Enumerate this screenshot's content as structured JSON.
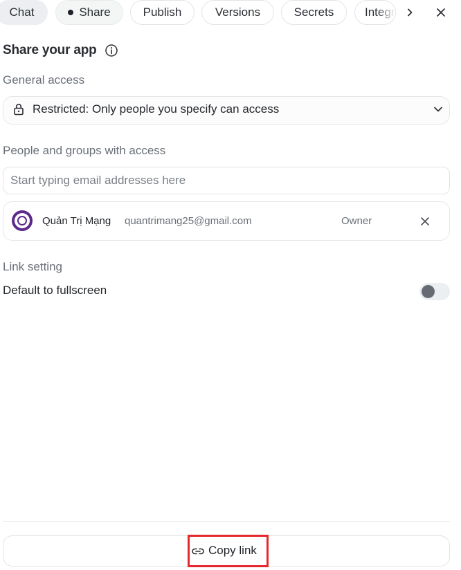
{
  "tabs": {
    "chat": "Chat",
    "share": "Share",
    "publish": "Publish",
    "versions": "Versions",
    "secrets": "Secrets",
    "integrations": "Integrations",
    "active": "share"
  },
  "icons": {
    "scroll_right": "chevron-right-icon",
    "close": "close-icon",
    "info": "info-icon",
    "lock": "lock-icon",
    "dropdown": "chevron-down-icon",
    "remove": "close-icon",
    "link": "link-icon"
  },
  "share": {
    "title": "Share your app",
    "general_access_label": "General access",
    "access_value": "Restricted: Only people you specify can access",
    "people_label": "People and groups with access",
    "email_placeholder": "Start typing email addresses here",
    "email_value": "",
    "users": [
      {
        "name": "Quản Trị Mạng",
        "email": "quantrimang25@gmail.com",
        "role": "Owner"
      }
    ]
  },
  "link_setting": {
    "label": "Link setting",
    "fullscreen_label": "Default to fullscreen",
    "fullscreen_enabled": false
  },
  "footer": {
    "copy_link_label": "Copy link"
  },
  "colors": {
    "highlight": "#e5282b",
    "avatar": "#5c2a8a",
    "toggle_off": "#666b73"
  }
}
